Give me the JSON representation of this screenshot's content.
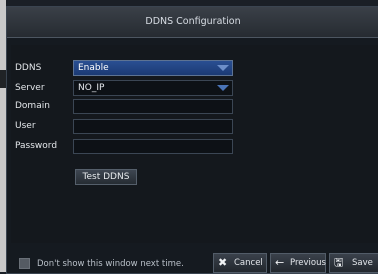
{
  "window": {
    "title": "DDNS Configuration"
  },
  "form": {
    "ddns": {
      "label": "DDNS",
      "value": "Enable"
    },
    "server": {
      "label": "Server",
      "value": "NO_IP"
    },
    "domain": {
      "label": "Domain",
      "value": ""
    },
    "user": {
      "label": "User",
      "value": ""
    },
    "password": {
      "label": "Password",
      "value": ""
    },
    "test_button": "Test DDNS"
  },
  "footer": {
    "checkbox_label": "Don't show this window next time.",
    "cancel": "Cancel",
    "previous": "Previous",
    "save": "Save"
  },
  "icons": {
    "cancel": "close-icon",
    "previous": "arrow-left-icon",
    "save": "floppy-disk-icon",
    "dropdown": "chevron-down-icon"
  },
  "colors": {
    "accent": "#2a4f92",
    "background": "#151a20",
    "titlebar": "#30363d"
  }
}
